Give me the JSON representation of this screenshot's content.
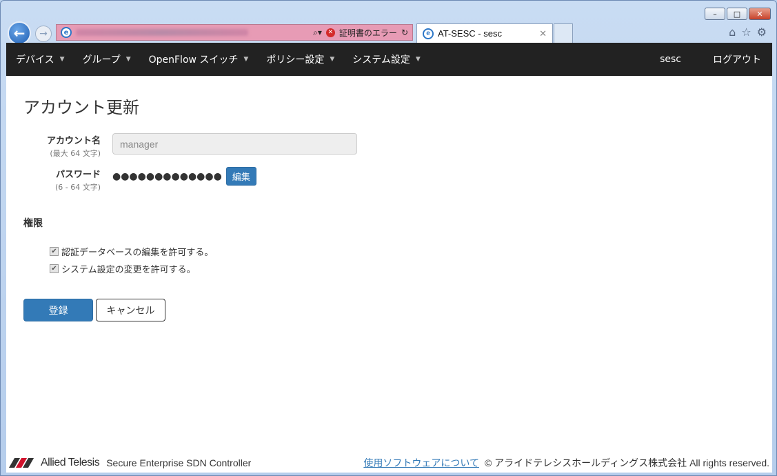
{
  "browser": {
    "tab_title": "AT-SESC - sesc",
    "cert_error": "証明書のエラー",
    "window_buttons": [
      "–",
      "□",
      "✕"
    ]
  },
  "navbar": {
    "items": [
      {
        "label": "デバイス"
      },
      {
        "label": "グループ"
      },
      {
        "label": "OpenFlow スイッチ"
      },
      {
        "label": "ポリシー設定"
      },
      {
        "label": "システム設定"
      }
    ],
    "user": "sesc",
    "logout": "ログアウト"
  },
  "form": {
    "title": "アカウント更新",
    "account": {
      "label": "アカウント名",
      "hint": "(最大 64 文字)",
      "value": "manager"
    },
    "password": {
      "label": "パスワード",
      "hint": "(6 - 64 文字)",
      "masked": "●●●●●●●●●●●●●",
      "edit_label": "編集"
    },
    "permissions": {
      "title": "権限",
      "items": [
        {
          "label": "認証データベースの編集を許可する。",
          "checked": true
        },
        {
          "label": "システム設定の変更を許可する。",
          "checked": true
        }
      ]
    },
    "submit_label": "登録",
    "cancel_label": "キャンセル"
  },
  "footer": {
    "logo_text": "Allied Telesis",
    "product": "Secure Enterprise SDN Controller",
    "link": "使用ソフトウェアについて",
    "copyright": "© アライドテレシスホールディングス株式会社 All rights reserved."
  },
  "colors": {
    "primary": "#337ab7",
    "navbar_bg": "#222222",
    "logo_red": "#d0112b"
  }
}
